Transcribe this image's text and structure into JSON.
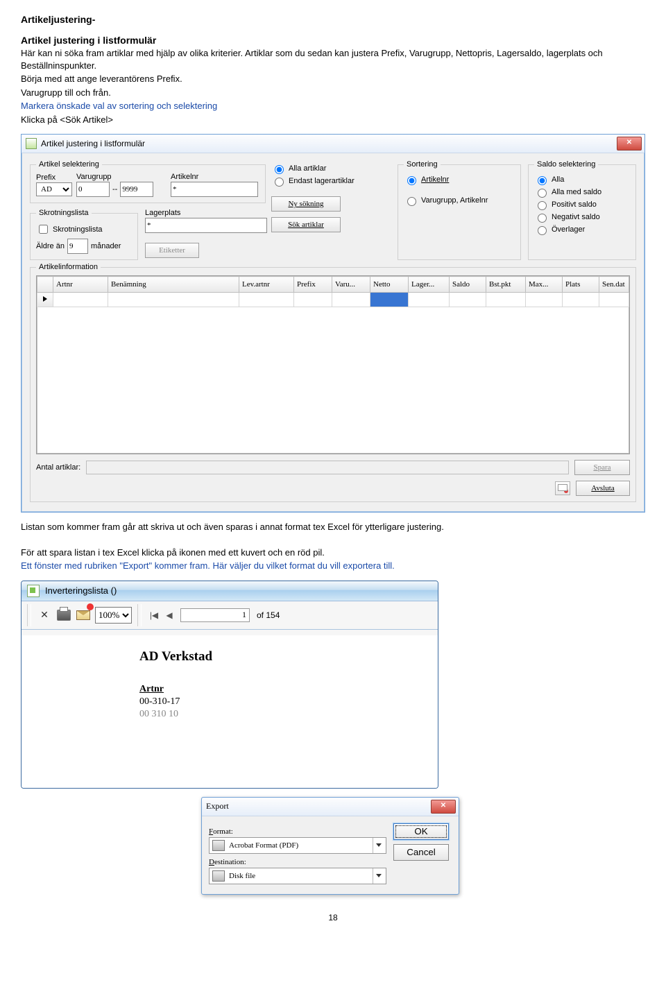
{
  "doc": {
    "title": "Artikeljustering-",
    "subtitle": "Artikel justering i listformulär",
    "intro1": "Här kan ni söka fram artiklar med hjälp av olika kriterier. Artiklar som du sedan kan justera Prefix, Varugrupp, Nettopris, Lagersaldo, lagerplats och Beställninspunkter.",
    "intro2": "Börja med att ange leverantörens Prefix.",
    "intro3": "Varugrupp till och från.",
    "intro4": "Markera önskade val av sortering och selektering",
    "intro5": "Klicka på <Sök Artikel>",
    "after1": "Listan som kommer fram går att skriva ut och även sparas i annat format tex Excel för ytterligare justering.",
    "after2": "För att spara listan i tex Excel klicka på ikonen med ett kuvert och en röd pil.",
    "after3": "Ett fönster med rubriken \"Export\" kommer fram. Här väljer du vilket format du vill exportera till.",
    "page_number": "18"
  },
  "dlg1": {
    "title": "Artikel justering i listformulär",
    "grp_artikel_sel": "Artikel selektering",
    "lbl_prefix": "Prefix",
    "val_prefix": "AD",
    "lbl_varugrupp": "Varugrupp",
    "val_vg_from": "0",
    "dashdash": "--",
    "val_vg_to": "9999",
    "lbl_artikelnr": "Artikelnr",
    "val_artikelnr": "*",
    "grp_skrot": "Skrotningslista",
    "chk_skrot": "Skrotningslista",
    "lbl_aldre": "Äldre än",
    "val_aldre": "9",
    "lbl_manader": "månader",
    "lbl_lagerplats": "Lagerplats",
    "val_lagerplats": "*",
    "btn_etiketter": "Etiketter",
    "radio_alla": "Alla artiklar",
    "radio_endast": "Endast lagerartiklar",
    "btn_ny": "Ny sökning",
    "btn_sok": "Sök artiklar",
    "grp_sort": "Sortering",
    "sort_art": "Artikelnr",
    "sort_vg": "Varugrupp, Artikelnr",
    "grp_saldo": "Saldo selektering",
    "saldo_alla": "Alla",
    "saldo_med": "Alla med saldo",
    "saldo_pos": "Positivt saldo",
    "saldo_neg": "Negativt saldo",
    "saldo_over": "Överlager",
    "grp_info": "Artikelinformation",
    "cols": [
      "Artnr",
      "Benämning",
      "Lev.artnr",
      "Prefix",
      "Varu...",
      "Netto",
      "Lager...",
      "Saldo",
      "Bst.pkt",
      "Max...",
      "Plats",
      "Sen.dat"
    ],
    "lbl_antal": "Antal artiklar:",
    "btn_spara": "Spara",
    "btn_avsluta": "Avsluta"
  },
  "viewer": {
    "title": "Inverteringslista ()",
    "zoom": "100%",
    "page": "1",
    "of": "of 154",
    "doc_title": "AD Verkstad",
    "col_head": "Artnr",
    "row1": "00-310-17",
    "row2": "00 310 10"
  },
  "export": {
    "title": "Export",
    "lbl_format": "Format:",
    "val_format": "Acrobat Format (PDF)",
    "lbl_dest": "Destination:",
    "val_dest": "Disk file",
    "btn_ok": "OK",
    "btn_cancel": "Cancel"
  }
}
